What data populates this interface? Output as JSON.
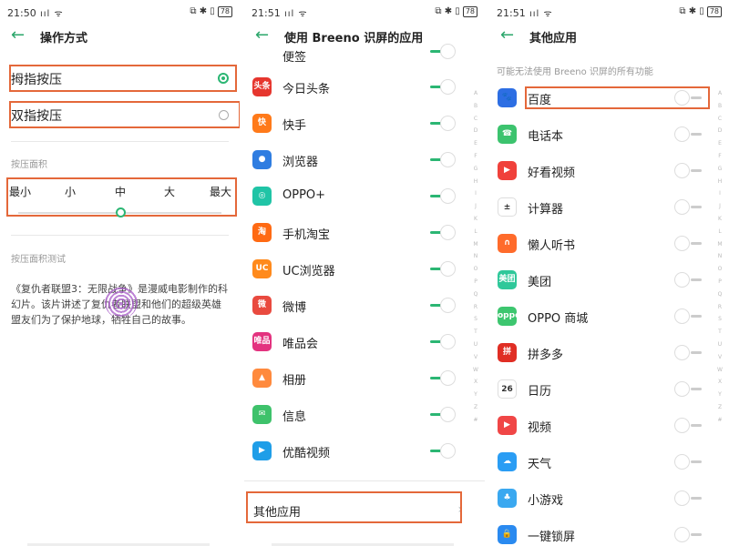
{
  "status": {
    "p1_time": "21:50",
    "p2_time": "21:51",
    "p3_time": "21:51",
    "signal": "ııl ᯤ",
    "right_icons": "⧉ ✱ ▯",
    "battery": "78"
  },
  "panel1": {
    "title": "操作方式",
    "option1": "拇指按压",
    "option2": "双指按压",
    "section_area": "按压面积",
    "sizes": [
      "最小",
      "小",
      "中",
      "大",
      "最大"
    ],
    "section_test": "按压面积测试",
    "paragraph": "《复仇者联盟3：无限战争》是漫威电影制作的科幻片。该片讲述了复仇者联盟和他们的超级英雄盟友们为了保护地球，牺牲自己的故事。"
  },
  "panel2": {
    "title": "使用 Breeno 识屏的应用",
    "partial_label": "便签",
    "apps": [
      {
        "label": "今日头条",
        "icon_text": "头条",
        "color": "#e6362e",
        "icon": "toutiao-icon"
      },
      {
        "label": "快手",
        "icon_text": "快",
        "color": "#ff7a1a",
        "icon": "kuaishou-icon"
      },
      {
        "label": "浏览器",
        "icon_text": "●",
        "color": "#2f7de1",
        "icon": "browser-icon"
      },
      {
        "label": "OPPO+",
        "icon_text": "◎",
        "color": "#20c4a6",
        "icon": "oppo-plus-icon"
      },
      {
        "label": "手机淘宝",
        "icon_text": "淘",
        "color": "#ff6a13",
        "icon": "taobao-icon"
      },
      {
        "label": "UC浏览器",
        "icon_text": "UC",
        "color": "#ff8a1c",
        "icon": "uc-browser-icon"
      },
      {
        "label": "微博",
        "icon_text": "微",
        "color": "#e94a3f",
        "icon": "weibo-icon"
      },
      {
        "label": "唯品会",
        "icon_text": "唯品",
        "color": "#e3337f",
        "icon": "vipshop-icon"
      },
      {
        "label": "相册",
        "icon_text": "▲",
        "color": "#ff8a3d",
        "icon": "gallery-icon"
      },
      {
        "label": "信息",
        "icon_text": "✉",
        "color": "#3ec26b",
        "icon": "messages-icon"
      },
      {
        "label": "优酷视频",
        "icon_text": "▶",
        "color": "#1f9ee8",
        "icon": "youku-icon"
      }
    ],
    "other_apps": "其他应用",
    "alphabet": [
      "A",
      "B",
      "C",
      "D",
      "E",
      "F",
      "G",
      "H",
      "I",
      "J",
      "K",
      "L",
      "M",
      "N",
      "O",
      "P",
      "Q",
      "R",
      "S",
      "T",
      "U",
      "V",
      "W",
      "X",
      "Y",
      "Z",
      "#"
    ]
  },
  "panel3": {
    "title": "其他应用",
    "note": "可能无法使用 Breeno 识屏的所有功能",
    "apps": [
      {
        "label": "百度",
        "icon_text": "🐾",
        "color": "#2d6ee3",
        "icon": "baidu-icon"
      },
      {
        "label": "电话本",
        "icon_text": "☎",
        "color": "#3cc36e",
        "icon": "contacts-icon"
      },
      {
        "label": "好看视频",
        "icon_text": "▶",
        "color": "#f0413b",
        "icon": "haokan-video-icon"
      },
      {
        "label": "计算器",
        "icon_text": "±",
        "color": "#ffffff",
        "icon": "calculator-icon"
      },
      {
        "label": "懒人听书",
        "icon_text": "∩",
        "color": "#ff6b2b",
        "icon": "lazy-audiobook-icon"
      },
      {
        "label": "美团",
        "icon_text": "美团",
        "color": "#2fc89a",
        "icon": "meituan-icon"
      },
      {
        "label": "OPPO 商城",
        "icon_text": "oppo",
        "color": "#3dc66f",
        "icon": "oppo-store-icon"
      },
      {
        "label": "拼多多",
        "icon_text": "拼",
        "color": "#e02e24",
        "icon": "pinduoduo-icon"
      },
      {
        "label": "日历",
        "icon_text": "26",
        "color": "#ffffff",
        "icon": "calendar-icon"
      },
      {
        "label": "视频",
        "icon_text": "▶",
        "color": "#f04646",
        "icon": "video-icon"
      },
      {
        "label": "天气",
        "icon_text": "☁",
        "color": "#2a9df4",
        "icon": "weather-icon"
      },
      {
        "label": "小游戏",
        "icon_text": "♣",
        "color": "#3aa8f0",
        "icon": "mini-games-icon"
      },
      {
        "label": "一键锁屏",
        "icon_text": "🔒",
        "color": "#2a8af0",
        "icon": "lock-screen-icon"
      }
    ],
    "alphabet": [
      "A",
      "B",
      "C",
      "D",
      "E",
      "F",
      "G",
      "H",
      "I",
      "J",
      "K",
      "L",
      "M",
      "N",
      "O",
      "P",
      "Q",
      "R",
      "S",
      "T",
      "U",
      "V",
      "W",
      "X",
      "Y",
      "Z",
      "#"
    ]
  },
  "colors": {
    "accent": "#2bb673",
    "highlight": "#e4683a"
  }
}
